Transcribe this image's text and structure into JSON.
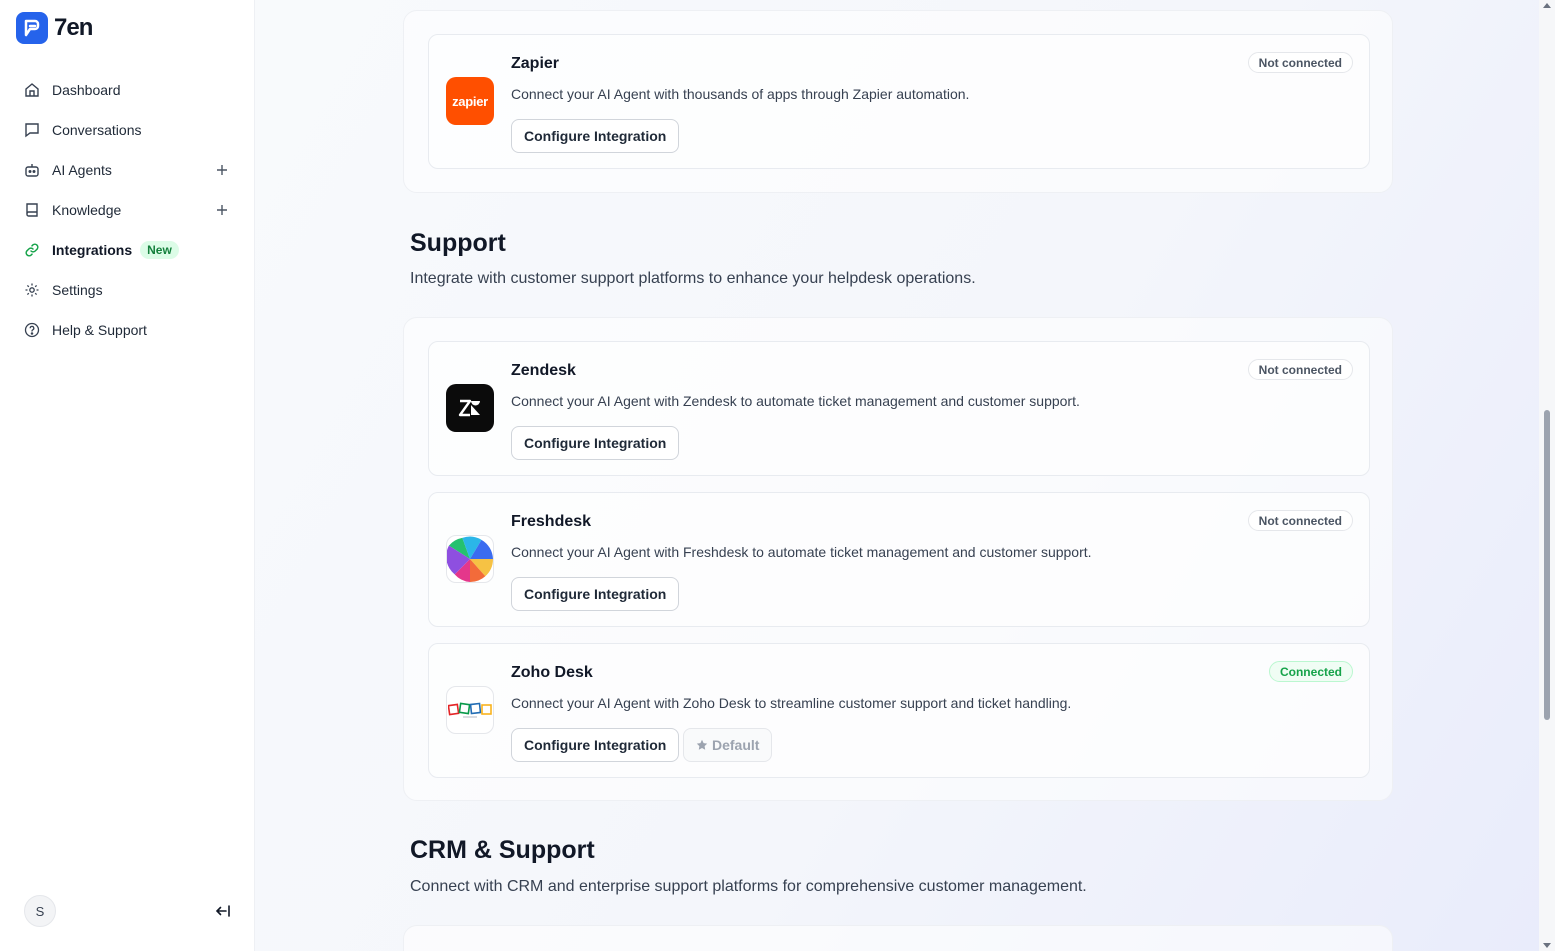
{
  "app": {
    "name": "7en"
  },
  "sidebar": {
    "items": [
      {
        "label": "Dashboard",
        "icon": "home-icon"
      },
      {
        "label": "Conversations",
        "icon": "message-icon"
      },
      {
        "label": "AI Agents",
        "icon": "bot-icon",
        "has_add": true
      },
      {
        "label": "Knowledge",
        "icon": "book-icon",
        "has_add": true
      },
      {
        "label": "Integrations",
        "icon": "link-icon",
        "badge": "New",
        "active": true
      },
      {
        "label": "Settings",
        "icon": "gear-icon"
      },
      {
        "label": "Help & Support",
        "icon": "help-circle-icon"
      }
    ],
    "user_initial": "S"
  },
  "sections": {
    "automation": {
      "cards": [
        {
          "name": "Zapier",
          "description": "Connect your AI Agent with thousands of apps through Zapier automation.",
          "status": "Not connected",
          "button": "Configure Integration",
          "icon_text": "zapier"
        }
      ]
    },
    "support": {
      "title": "Support",
      "subtitle": "Integrate with customer support platforms to enhance your helpdesk operations.",
      "cards": [
        {
          "name": "Zendesk",
          "description": "Connect your AI Agent with Zendesk to automate ticket management and customer support.",
          "status": "Not connected",
          "button": "Configure Integration"
        },
        {
          "name": "Freshdesk",
          "description": "Connect your AI Agent with Freshdesk to automate ticket management and customer support.",
          "status": "Not connected",
          "button": "Configure Integration"
        },
        {
          "name": "Zoho Desk",
          "description": "Connect your AI Agent with Zoho Desk to streamline customer support and ticket handling.",
          "status": "Connected",
          "button": "Configure Integration",
          "default_label": "Default"
        }
      ]
    },
    "crm_support": {
      "title": "CRM & Support",
      "subtitle": "Connect with CRM and enterprise support platforms for comprehensive customer management."
    }
  },
  "colors": {
    "accent": "#2563eb",
    "zapier": "#ff4f00",
    "connected": "#16a34a",
    "new_badge": "#15803d"
  }
}
